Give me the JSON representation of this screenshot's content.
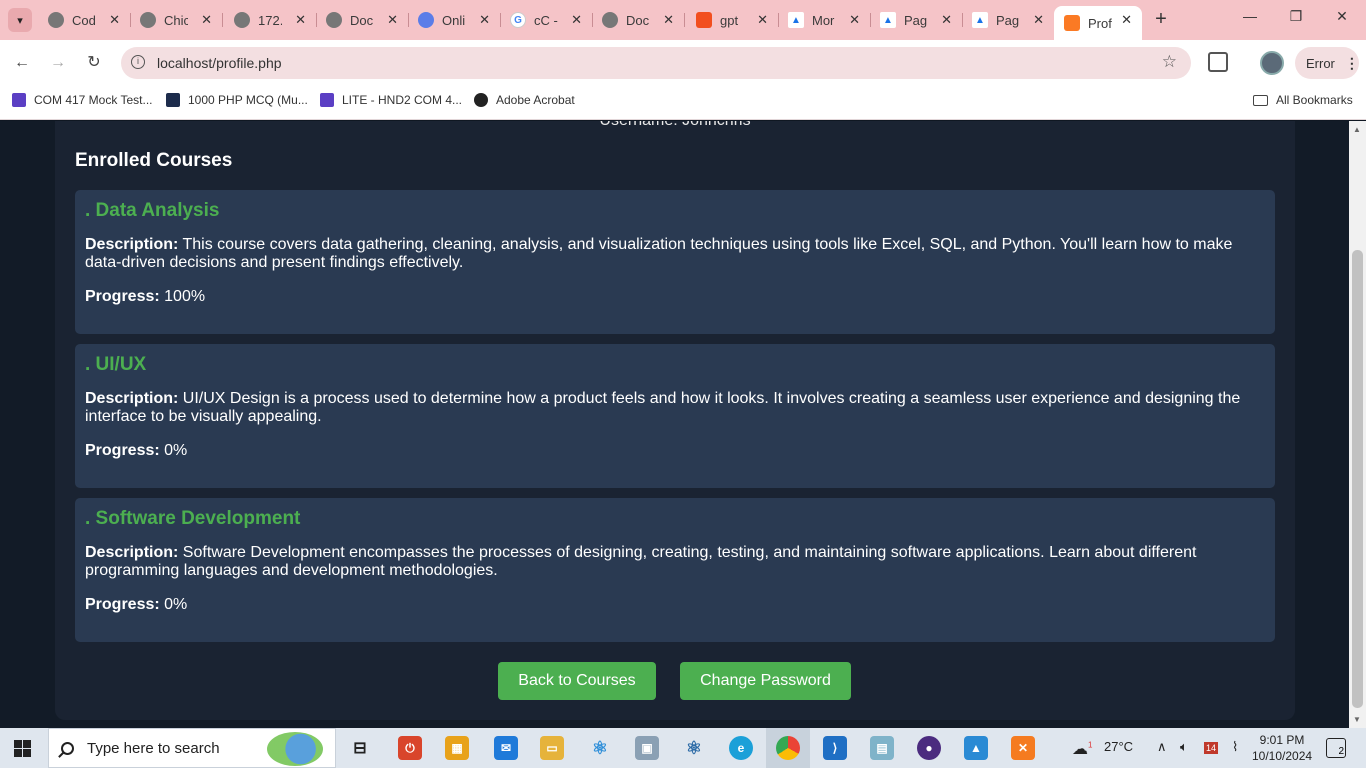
{
  "browser": {
    "tabs": [
      {
        "title": "Cod",
        "fav_color": "#777777"
      },
      {
        "title": "Chic",
        "fav_color": "#777777"
      },
      {
        "title": "172.",
        "fav_color": "#777777"
      },
      {
        "title": "Doc",
        "fav_color": "#777777"
      },
      {
        "title": "Onli",
        "fav_color": "#5b7de8"
      },
      {
        "title": "cC -",
        "fav_color": "#4285f4"
      },
      {
        "title": "Doc",
        "fav_color": "#777777"
      },
      {
        "title": "gpt",
        "fav_color": "#f24e1e"
      },
      {
        "title": "Mor",
        "fav_color": "#1a73e8"
      },
      {
        "title": "Pag",
        "fav_color": "#1a73e8"
      },
      {
        "title": "Pag",
        "fav_color": "#1a73e8"
      },
      {
        "title": "Prof",
        "fav_color": "#fb7a24",
        "active": true
      }
    ],
    "tab_close_glyph": "✕",
    "new_tab_glyph": "+",
    "window_controls": {
      "minimize": "—",
      "maximize": "❐",
      "close": "✕"
    },
    "address": "localhost/profile.php",
    "error_label": "Error",
    "bookmarks": [
      {
        "label": "COM 417 Mock Test...",
        "color": "#5b3fc4"
      },
      {
        "label": "1000 PHP MCQ (Mu...",
        "color": "#1d2c4c"
      },
      {
        "label": "LITE - HND2 COM 4...",
        "color": "#5b3fc4"
      },
      {
        "label": "Adobe Acrobat",
        "color": "#222222"
      }
    ],
    "all_bookmarks": "All Bookmarks"
  },
  "page": {
    "username_line": "Username: Johnchris",
    "section_title": "Enrolled Courses",
    "description_label": "Description:",
    "progress_label": "Progress:",
    "courses": [
      {
        "title": ". Data Analysis",
        "description": "This course covers data gathering, cleaning, analysis, and visualization techniques using tools like Excel, SQL, and Python. You'll learn how to make data-driven decisions and present findings effectively.",
        "progress": "100%"
      },
      {
        "title": ". UI/UX",
        "description": "UI/UX Design is a process used to determine how a product feels and how it looks. It involves creating a seamless user experience and designing the interface to be visually appealing.",
        "progress": "0%"
      },
      {
        "title": ". Software Development",
        "description": "Software Development encompasses the processes of designing, creating, testing, and maintaining software applications. Learn about different programming languages and development methodologies.",
        "progress": "0%"
      }
    ],
    "buttons": {
      "back": "Back to Courses",
      "change_password": "Change Password"
    },
    "accent_color": "#4caf50"
  },
  "taskbar": {
    "search_placeholder": "Type here to search",
    "weather": "27°C",
    "time": "9:01 PM",
    "date": "10/10/2024",
    "notifications": "2",
    "calendar_badge": "14",
    "weather_badge": "1"
  }
}
